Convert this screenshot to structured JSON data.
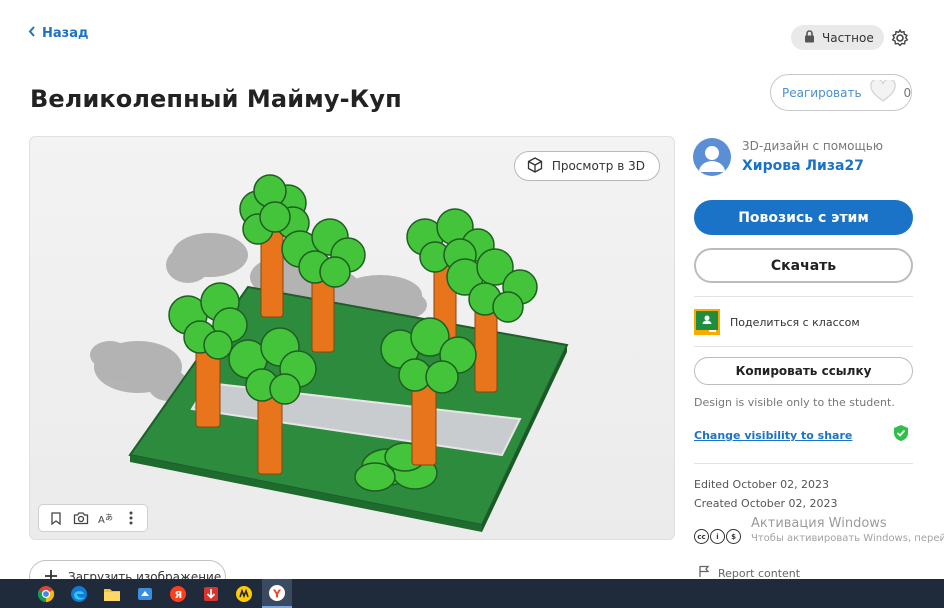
{
  "header": {
    "back_label": "Назад",
    "privacy_label": "Частное"
  },
  "page_title": "Великолепный Майму-Куп",
  "react": {
    "label": "Реагировать",
    "count": "0"
  },
  "viewer": {
    "view3d_label": "Просмотр в 3D"
  },
  "upload_label": "Загрузить изображение",
  "sidebar": {
    "made_with": "3D-дизайн с помощью",
    "author": "Хирова Лиза27",
    "tinker_label": "Повозись с этим",
    "download_label": "Скачать",
    "share_class_label": "Поделиться с классом",
    "copy_link_label": "Копировать ссылку",
    "visibility_note": "Design is visible only to the student.",
    "change_visibility_label": "Change visibility to share",
    "edited": "Edited October 02, 2023",
    "created": "Created October 02, 2023",
    "report_label": "Report content"
  },
  "watermark": {
    "title": "Активация Windows",
    "subtitle": "Чтобы активировать Windows, перейдите"
  },
  "taskbar": {
    "icons": [
      "chrome-icon",
      "edge-icon",
      "file-explorer-icon",
      "app-icon",
      "yandex-icon",
      "download-icon",
      "yandex-music-icon",
      "yandex-browser-icon"
    ]
  },
  "colors": {
    "accent": "#1a73c7",
    "tree_leaves": "#43c43a",
    "tree_trunk": "#e8751c",
    "ground": "#2b8a3e",
    "path": "#c9cccf"
  }
}
